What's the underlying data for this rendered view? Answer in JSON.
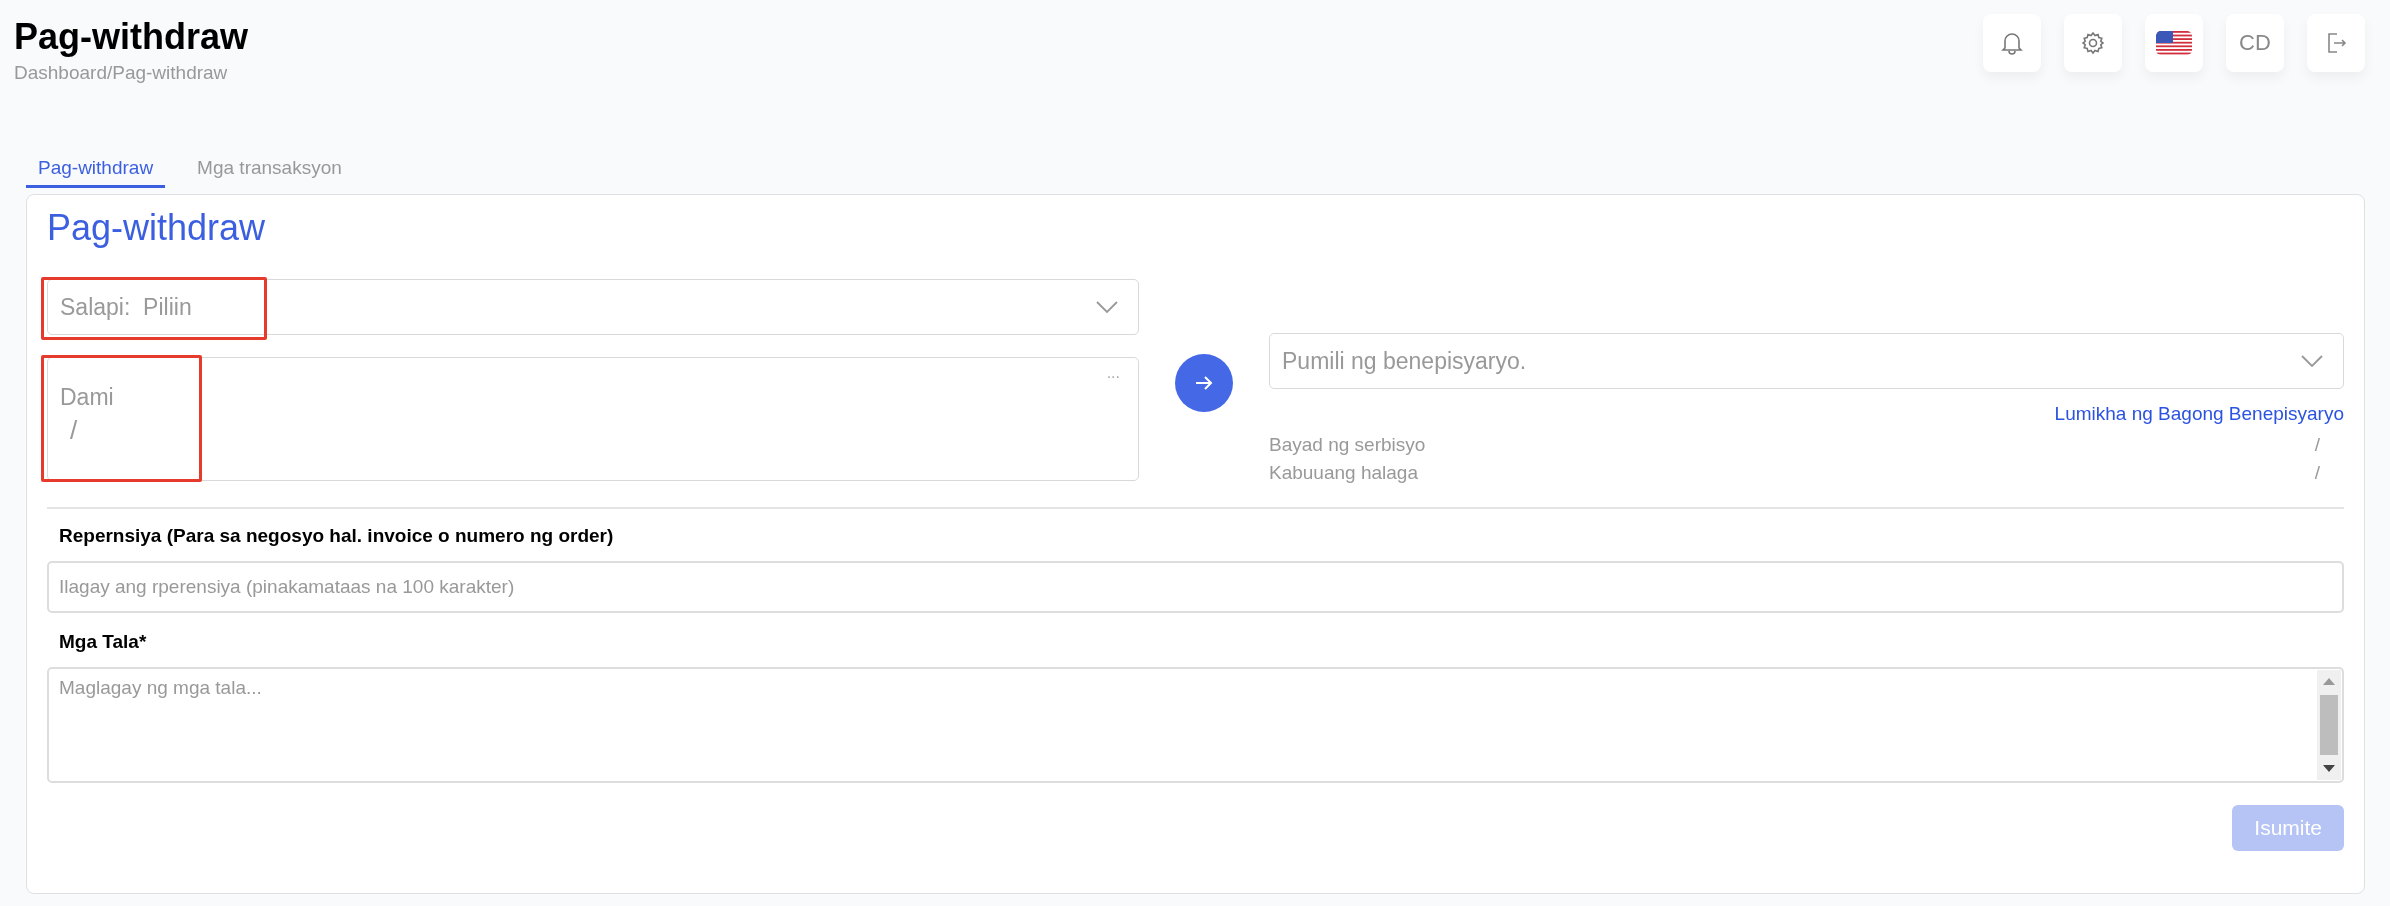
{
  "header": {
    "title": "Pag-withdraw",
    "breadcrumb": "Dashboard/Pag-withdraw",
    "profile_initials": "CD"
  },
  "tabs": [
    {
      "label": "Pag-withdraw",
      "selected": true
    },
    {
      "label": "Mga transaksyon",
      "selected": false
    }
  ],
  "form": {
    "title": "Pag-withdraw",
    "currency": {
      "label": "Salapi:",
      "placeholder": "Piliin",
      "highlighted": true
    },
    "amount": {
      "label": "Dami",
      "value": "/",
      "menu": "...",
      "highlighted": true
    },
    "beneficiary": {
      "placeholder": "Pumili ng benepisyaryo.",
      "create_link": "Lumikha ng Bagong Benepisyaryo"
    },
    "summary": [
      {
        "label": "Bayad ng serbisyo",
        "value": "/"
      },
      {
        "label": "Kabuuang halaga",
        "value": "/"
      }
    ],
    "reference": {
      "label": "Repernsiya (Para sa negosyo hal. invoice o numero ng order)",
      "placeholder": "Ilagay ang rperensiya (pinakamataas na 100 karakter)"
    },
    "notes": {
      "label": "Mga Tala*",
      "placeholder": "Maglagay ng mga tala..."
    },
    "submit": {
      "label": "Isumite",
      "disabled": true
    }
  }
}
